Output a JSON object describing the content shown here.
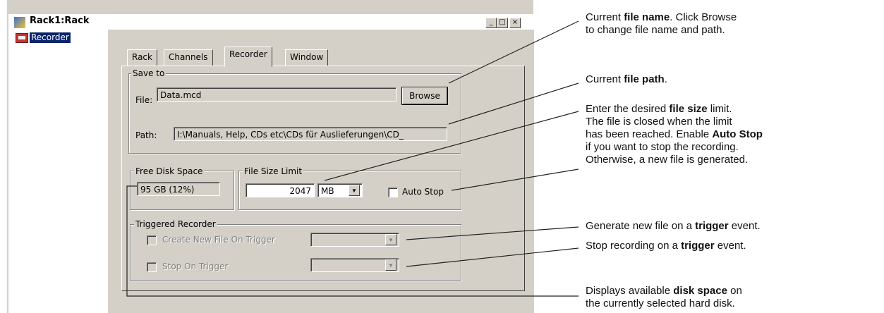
{
  "window": {
    "title": "Rack1:Rack",
    "buttons": {
      "minimize": "_",
      "maximize": "□",
      "close": "×"
    }
  },
  "tree": {
    "items": [
      {
        "label": "Recorder",
        "icon": "recorder-icon",
        "selected": true
      }
    ]
  },
  "tabs": [
    {
      "label": "Rack",
      "active": false
    },
    {
      "label": "Channels",
      "active": false
    },
    {
      "label": "Recorder",
      "active": true
    },
    {
      "label": "Window",
      "active": false
    }
  ],
  "save_to": {
    "group_label": "Save to",
    "file_label": "File:",
    "file_value": "Data.mcd",
    "browse_label": "Browse",
    "path_label": "Path:",
    "path_value": "I:\\Manuals, Help, CDs etc\\CDs für Auslieferungen\\CD_"
  },
  "free_disk": {
    "group_label": "Free Disk Space",
    "value": "95 GB  (12%)"
  },
  "file_size": {
    "group_label": "File Size Limit",
    "value": "2047",
    "unit": "MB",
    "auto_stop_label": "Auto Stop",
    "auto_stop_checked": false
  },
  "triggered": {
    "group_label": "Triggered Recorder",
    "create_label": "Create New File On Trigger",
    "stop_label": "Stop On Trigger"
  },
  "annotations": {
    "a1": {
      "l1a": "Current ",
      "l1b": "file name",
      "l1c": ". Click Browse",
      "l2": "to change file name and path."
    },
    "a2": {
      "a": "Current ",
      "b": "file path",
      "c": "."
    },
    "a3": {
      "l1a": "Enter the desired ",
      "l1b": "file size",
      "l1c": " limit.",
      "l2": "The file is closed when the limit",
      "l3a": "has been reached. Enable ",
      "l3b": "Auto Stop",
      "l4": "if you want to stop the recording.",
      "l5": "Otherwise, a new file is generated."
    },
    "a4": {
      "a": "Generate new file on a ",
      "b": "trigger",
      "c": " event."
    },
    "a5": {
      "a": "Stop recording on a ",
      "b": "trigger",
      "c": " event."
    },
    "a6": {
      "l1a": "Displays available ",
      "l1b": "disk space",
      "l1c": " on",
      "l2": "the currently selected hard disk."
    }
  }
}
